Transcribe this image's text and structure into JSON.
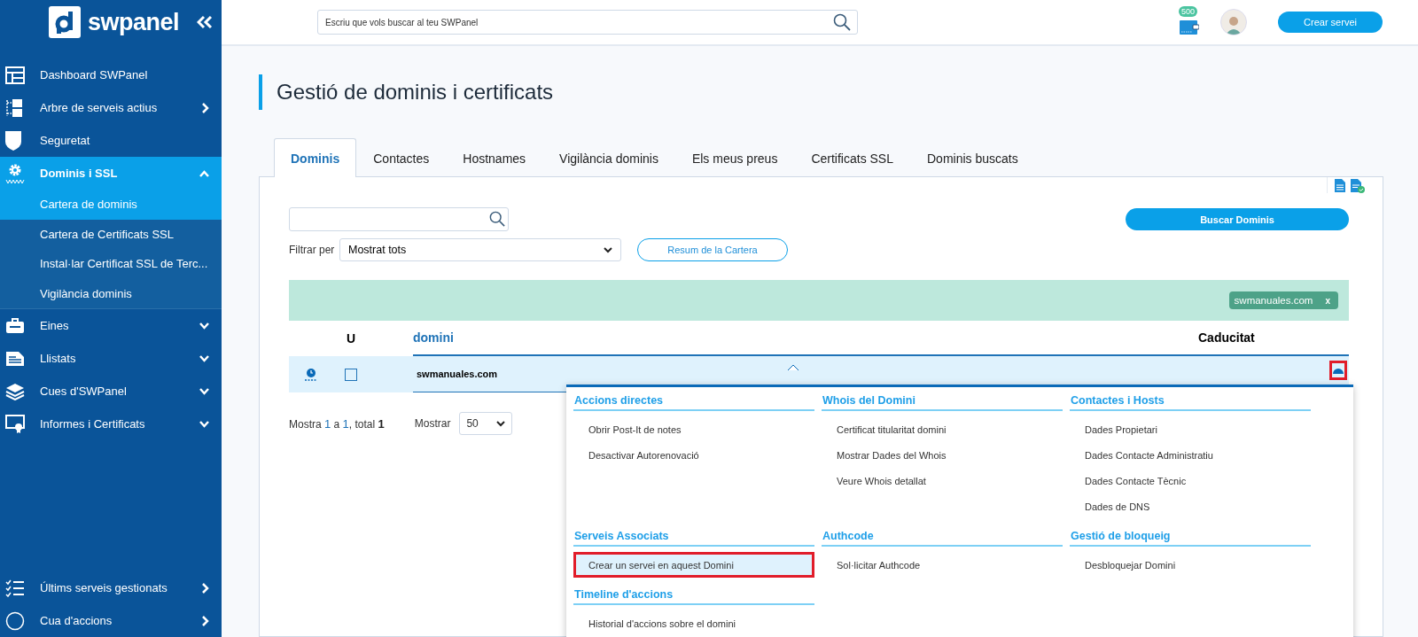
{
  "sidebar": {
    "logo": "swpanel",
    "items": [
      {
        "label": "Dashboard SWPanel",
        "selected": false
      },
      {
        "label": "Arbre de serveis actius",
        "selected": false
      },
      {
        "label": "Seguretat",
        "selected": false
      },
      {
        "label": "Dominis i SSL",
        "selected": true,
        "expanded": true,
        "children": [
          {
            "label": "Cartera de dominis",
            "selected": true
          },
          {
            "label": "Cartera de Certificats SSL",
            "selected": false
          },
          {
            "label": "Instal·lar Certificat SSL de Terc...",
            "selected": false
          },
          {
            "label": "Vigilància dominis",
            "selected": false
          }
        ]
      },
      {
        "label": "Eines",
        "selected": false,
        "expanded": false
      },
      {
        "label": "Llistats",
        "selected": false,
        "expanded": false
      },
      {
        "label": "Cues d'SWPanel",
        "selected": false,
        "expanded": false
      },
      {
        "label": "Informes i Certificats",
        "selected": false,
        "expanded": false
      }
    ],
    "bottom_items": [
      {
        "label": "Últims serveis gestionats"
      },
      {
        "label": "Cua d'accions"
      }
    ]
  },
  "topbar": {
    "search": {
      "placeholder": "Escriu que vols buscar al teu SWPanel"
    },
    "badge": "500",
    "create_button": "Crear servei"
  },
  "page_title": "Gestió de dominis i certificats",
  "tabs": [
    {
      "label": "Dominis",
      "selected": true
    },
    {
      "label": "Contactes",
      "selected": false
    },
    {
      "label": "Hostnames",
      "selected": false
    },
    {
      "label": "Vigilància dominis",
      "selected": false
    },
    {
      "label": "Els meus preus",
      "selected": false
    },
    {
      "label": "Certificats SSL",
      "selected": false
    },
    {
      "label": "Dominis buscats",
      "selected": false
    }
  ],
  "search_button": "Buscar Dominis",
  "filter": {
    "label": "Filtrar per",
    "value": "Mostrat tots"
  },
  "summary_button": "Resum de la Cartera",
  "filter_tags": [
    {
      "label": "swmanuales.com",
      "remove": "x"
    }
  ],
  "table": {
    "columns": [
      "U",
      "domini",
      "Caducitat"
    ],
    "rows": [
      {
        "domain": "swmanuales.com",
        "checked": false,
        "action_highlighted": true
      }
    ]
  },
  "pagination": {
    "prefix": "Mostra ",
    "from": "1",
    "middle": " a ",
    "to": "1",
    "total_label": ", total ",
    "total": "1",
    "show_label": "Mostrar",
    "page_size": "50"
  },
  "action_menu": {
    "groups": [
      {
        "title": "Accions directes",
        "items": [
          {
            "label": "Obrir Post-It de notes",
            "highlighted": false
          },
          {
            "label": "Desactivar Autorenovació",
            "highlighted": false
          }
        ]
      },
      {
        "title": "Whois del Domini",
        "items": [
          {
            "label": "Certificat titularitat domini",
            "highlighted": false
          },
          {
            "label": "Mostrar Dades del Whois",
            "highlighted": false
          },
          {
            "label": "Veure Whois detallat",
            "highlighted": false
          }
        ]
      },
      {
        "title": "Contactes i Hosts",
        "items": [
          {
            "label": "Dades Propietari",
            "highlighted": false
          },
          {
            "label": "Dades Contacte Administratiu",
            "highlighted": false
          },
          {
            "label": "Dades Contacte Tècnic",
            "highlighted": false
          },
          {
            "label": "Dades de DNS",
            "highlighted": false
          }
        ]
      },
      {
        "title": "Serveis Associats",
        "items": [
          {
            "label": "Crear un servei en aquest Domini",
            "highlighted": true
          }
        ]
      },
      {
        "title": "Authcode",
        "items": [
          {
            "label": "Sol·licitar Authcode",
            "highlighted": false
          }
        ]
      },
      {
        "title": "Gestió de bloqueig",
        "items": [
          {
            "label": "Desbloquejar Domini",
            "highlighted": false
          }
        ]
      },
      {
        "title": "Timeline d'accions",
        "items": [
          {
            "label": "Historial d'accions sobre el domini",
            "highlighted": false
          }
        ]
      }
    ]
  }
}
